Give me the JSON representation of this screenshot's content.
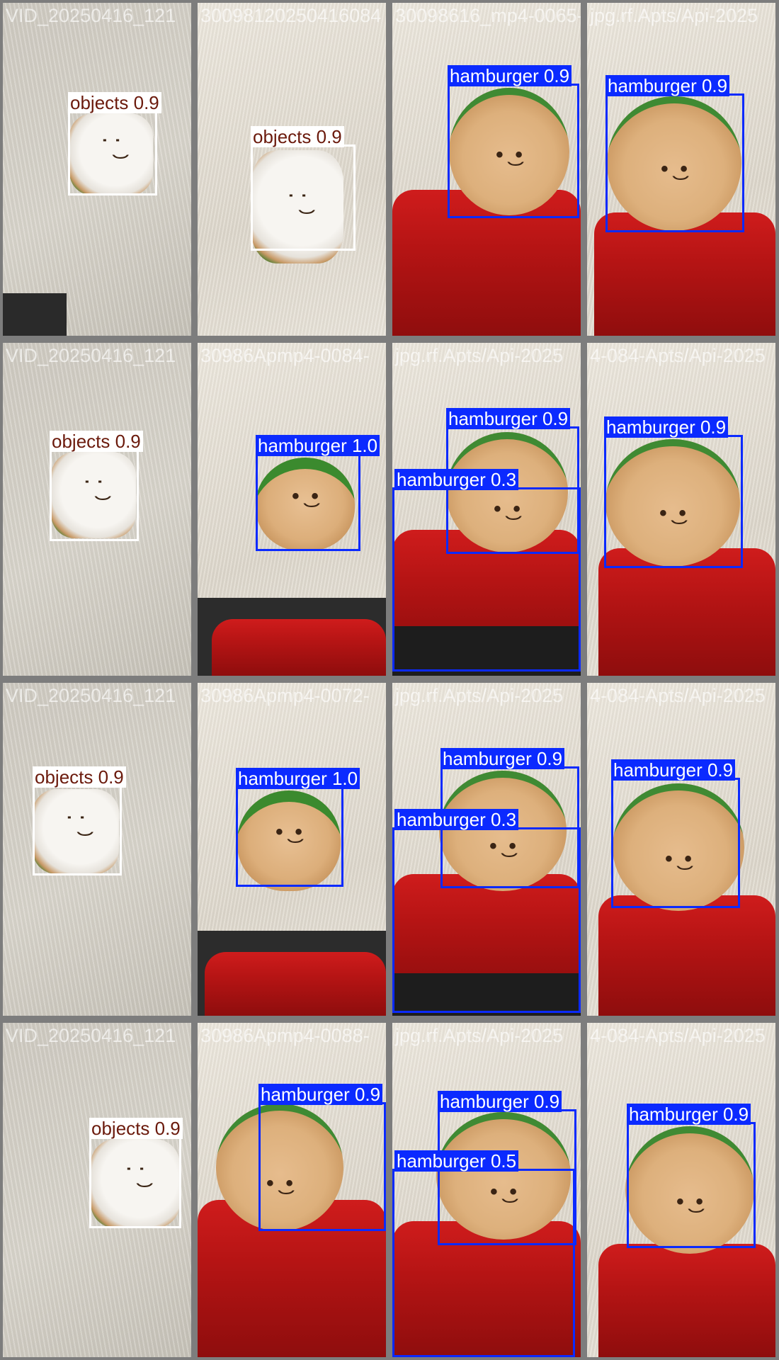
{
  "colors": {
    "objects_box": "#ffffff",
    "objects_label_text": "#6b1a0c",
    "hamburger_box": "#0b2aff",
    "hamburger_label_text": "#ffffff",
    "tile_border": "#7d7d7d"
  },
  "tiles": [
    {
      "id": "r1c1",
      "filename": "VID_20250416_121",
      "scene": "grey",
      "object": "sandwich",
      "boxes": [
        {
          "class": "objects",
          "label": "objects 0.9"
        }
      ]
    },
    {
      "id": "r1c2",
      "filename": "30098120250416084",
      "scene": "light",
      "object": "sandwich",
      "boxes": [
        {
          "class": "objects",
          "label": "objects 0.9"
        }
      ]
    },
    {
      "id": "r1c3",
      "filename": "30098616_mp4-0065-",
      "scene": "light-chair",
      "object": "bun",
      "boxes": [
        {
          "class": "hamburger",
          "label": "hamburger 0.9"
        }
      ]
    },
    {
      "id": "r1c4",
      "filename": "jpg.rf.Apts/Api-2025",
      "scene": "light-chair",
      "object": "bun",
      "boxes": [
        {
          "class": "hamburger",
          "label": "hamburger 0.9"
        }
      ]
    },
    {
      "id": "r2c1",
      "filename": "VID_20250416_121",
      "scene": "grey",
      "object": "sandwich",
      "boxes": [
        {
          "class": "objects",
          "label": "objects 0.9"
        }
      ]
    },
    {
      "id": "r2c2",
      "filename": "30986Apmp4-0084-",
      "scene": "light-chair",
      "object": "bun-side",
      "boxes": [
        {
          "class": "hamburger",
          "label": "hamburger 1.0"
        }
      ]
    },
    {
      "id": "r2c3",
      "filename": "jpg.rf.Apts/Api-2025",
      "scene": "light-chair",
      "object": "bun",
      "boxes": [
        {
          "class": "hamburger",
          "label": "hamburger 0.9"
        },
        {
          "class": "hamburger",
          "label": "hamburger 0.3"
        }
      ]
    },
    {
      "id": "r2c4",
      "filename": "4-084-Apts/Api-2025",
      "scene": "light-chair",
      "object": "bun",
      "boxes": [
        {
          "class": "hamburger",
          "label": "hamburger 0.9"
        }
      ]
    },
    {
      "id": "r3c1",
      "filename": "VID_20250416_121",
      "scene": "grey",
      "object": "sandwich",
      "boxes": [
        {
          "class": "objects",
          "label": "objects 0.9"
        }
      ]
    },
    {
      "id": "r3c2",
      "filename": "30986Apmp4-0072-",
      "scene": "light-chair",
      "object": "bun-side",
      "boxes": [
        {
          "class": "hamburger",
          "label": "hamburger 1.0"
        }
      ]
    },
    {
      "id": "r3c3",
      "filename": "jpg.rf.Apts/Api-2025",
      "scene": "light-chair",
      "object": "bun",
      "boxes": [
        {
          "class": "hamburger",
          "label": "hamburger 0.9"
        },
        {
          "class": "hamburger",
          "label": "hamburger 0.3"
        }
      ]
    },
    {
      "id": "r3c4",
      "filename": "4-084-Apts/Api-2025",
      "scene": "light-chair",
      "object": "bun",
      "boxes": [
        {
          "class": "hamburger",
          "label": "hamburger 0.9"
        }
      ]
    },
    {
      "id": "r4c1",
      "filename": "VID_20250416_121",
      "scene": "grey",
      "object": "sandwich",
      "boxes": [
        {
          "class": "objects",
          "label": "objects 0.9"
        }
      ]
    },
    {
      "id": "r4c2",
      "filename": "30986Apmp4-0088-",
      "scene": "light-chair",
      "object": "bun",
      "boxes": [
        {
          "class": "hamburger",
          "label": "hamburger 0.9"
        }
      ]
    },
    {
      "id": "r4c3",
      "filename": "jpg.rf.Apts/Api-2025",
      "scene": "light-chair",
      "object": "bun",
      "boxes": [
        {
          "class": "hamburger",
          "label": "hamburger 0.9"
        },
        {
          "class": "hamburger",
          "label": "hamburger 0.5"
        }
      ]
    },
    {
      "id": "r4c4",
      "filename": "4-084-Apts/Api-2025",
      "scene": "light-chair",
      "object": "bun",
      "boxes": [
        {
          "class": "hamburger",
          "label": "hamburger 0.9"
        }
      ]
    }
  ]
}
